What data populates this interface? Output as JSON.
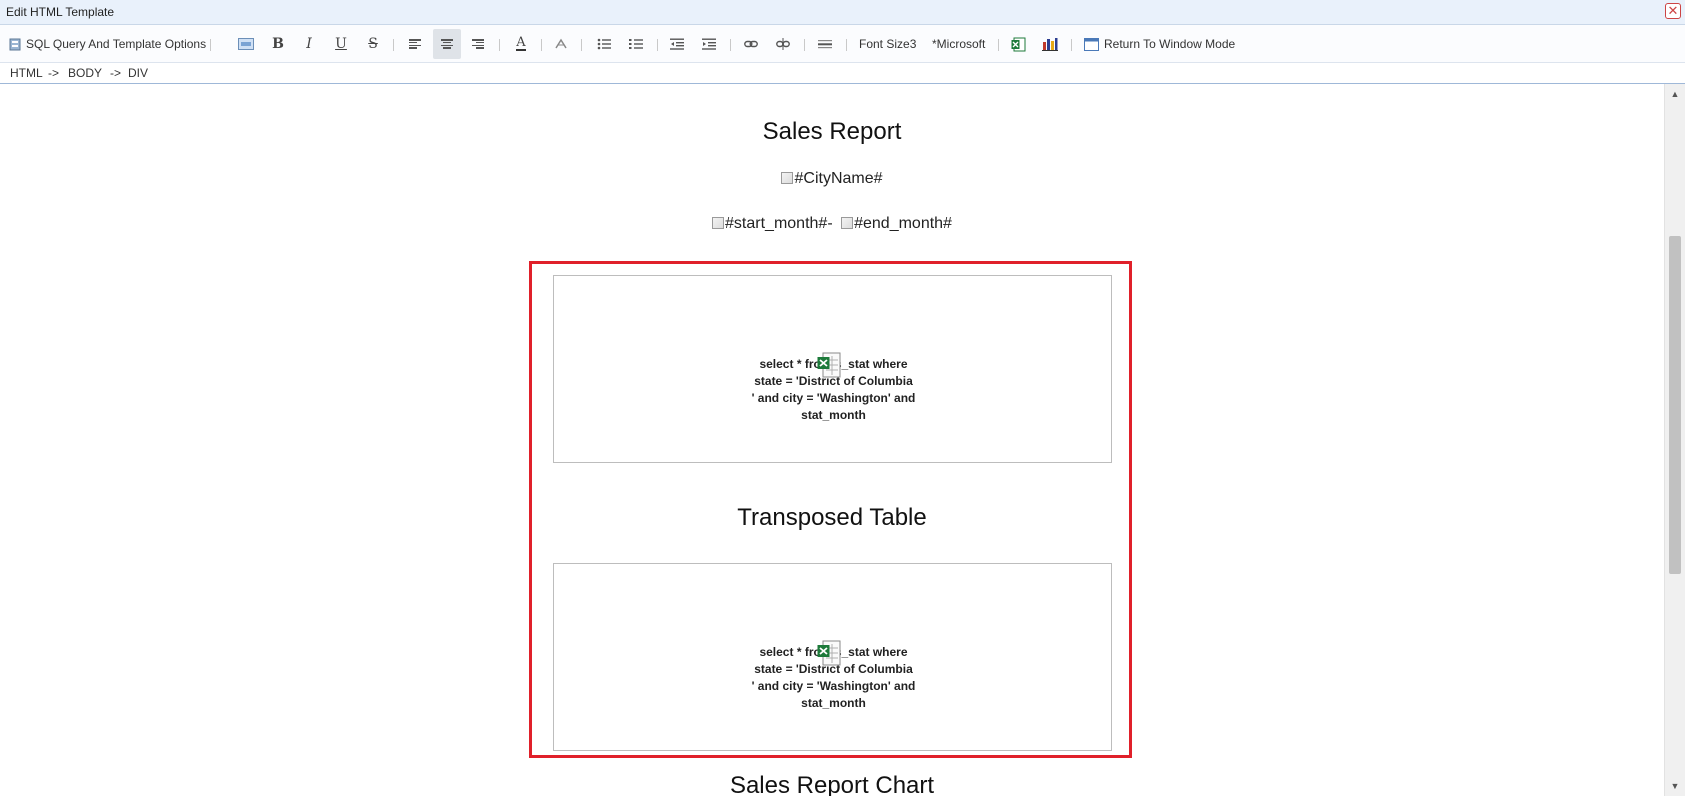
{
  "window": {
    "title": "Edit HTML Template",
    "close_glyph": "✕"
  },
  "toolbar": {
    "sql_options_label": "SQL Query And Template Options",
    "font_size_label": "Font Size3",
    "font_name_label": "*Microsoft",
    "return_label": "Return To Window Mode",
    "bold_glyph": "B",
    "italic_glyph": "I",
    "underline_glyph": "U",
    "strike_glyph": "S",
    "font_color_glyph": "A"
  },
  "breadcrumb": {
    "html": "HTML",
    "arrow1": "->",
    "body": "BODY",
    "arrow2": "->",
    "div": "DIV"
  },
  "document": {
    "title": "Sales Report",
    "city_placeholder": "#CityName#",
    "start_month": "#start_month#",
    "dash": "-",
    "end_month": "#end_month#",
    "table1": {
      "lines": [
        "select * from s_stat where",
        "state = 'District of Columbia",
        "' and city = 'Washington' and",
        "stat_month"
      ]
    },
    "transposed_title": "Transposed Table",
    "table2": {
      "lines": [
        "select * from s_stat where",
        "state = 'District of Columbia",
        "' and city = 'Washington' and",
        "stat_month"
      ]
    },
    "chart_title": "Sales Report Chart"
  },
  "colors": {
    "selection": "#e0202a",
    "excel_green": "#1d7a3a",
    "titlebar": "#e9f1fb"
  },
  "icons": [
    "database-icon",
    "image-icon",
    "bold-icon",
    "italic-icon",
    "underline-icon",
    "strikethrough-icon",
    "align-left-icon",
    "align-center-icon",
    "align-right-icon",
    "font-color-icon",
    "clear-format-icon",
    "bullet-list-icon",
    "numbered-list-icon",
    "outdent-icon",
    "indent-icon",
    "link-icon",
    "unlink-icon",
    "horizontal-rule-icon",
    "excel-table-icon",
    "chart-icon",
    "window-icon",
    "close-icon"
  ]
}
